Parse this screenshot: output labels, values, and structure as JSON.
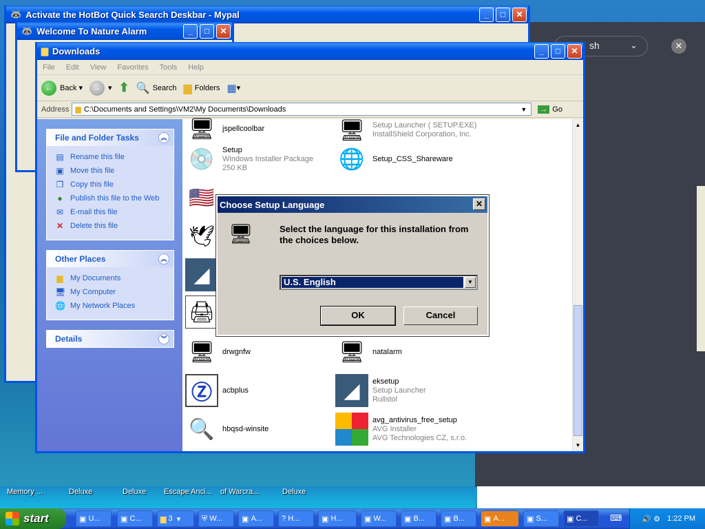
{
  "windows": {
    "hotbot": {
      "title": "Activate the HotBot Quick Search Deskbar - Mypal"
    },
    "alarm": {
      "title": "Welcome To Nature Alarm"
    },
    "explorer": {
      "title": "Downloads",
      "menu": [
        "File",
        "Edit",
        "View",
        "Favorites",
        "Tools",
        "Help"
      ],
      "toolbar": {
        "back": "Back",
        "search": "Search",
        "folders": "Folders"
      },
      "address_label": "Address",
      "address_value": "C:\\Documents and Settings\\VM2\\My Documents\\Downloads",
      "go_label": "Go"
    }
  },
  "taskpane": {
    "file_tasks": {
      "header": "File and Folder Tasks",
      "items": [
        "Rename this file",
        "Move this file",
        "Copy this file",
        "Publish this file to the Web",
        "E-mail this file",
        "Delete this file"
      ]
    },
    "other_places": {
      "header": "Other Places",
      "items": [
        "My Documents",
        "My Computer",
        "My Network Places"
      ]
    },
    "details": {
      "header": "Details"
    }
  },
  "files": [
    {
      "name": "jspellcoolbar",
      "line2": "",
      "line3": ""
    },
    {
      "name": "Setup Launcher ( SETUP.EXE)",
      "line2": "InstallShield Corporation, Inc.",
      "line3": ""
    },
    {
      "name": "Setup",
      "line2": "Windows Installer Package",
      "line3": "250 KB"
    },
    {
      "name": "Setup_CSS_Shareware",
      "line2": "",
      "line3": ""
    },
    {
      "name": "drwgnfw",
      "line2": "",
      "line3": ""
    },
    {
      "name": "natalarm",
      "line2": "",
      "line3": ""
    },
    {
      "name": "acbplus",
      "line2": "",
      "line3": ""
    },
    {
      "name": "eksetup",
      "line2": "Setup Launcher",
      "line3": "Rullstol"
    },
    {
      "name": "hbqsd-winsite",
      "line2": "",
      "line3": ""
    },
    {
      "name": "avg_antivirus_free_setup",
      "line2": "AVG Installer",
      "line3": "AVG Technologies CZ, s.r.o."
    }
  ],
  "dialog": {
    "title": "Choose Setup Language",
    "message": "Select the language for this installation from the choices below.",
    "selected_language": "U.S. English",
    "ok": "OK",
    "cancel": "Cancel"
  },
  "desktop_labels": [
    "Memory ...",
    "Deluxe",
    "Deluxe",
    "Escape Anci...",
    "of Warcra...",
    "Deluxe"
  ],
  "darkpane": {
    "search_text": "sh"
  },
  "taskbar": {
    "start": "start",
    "buttons": [
      "U...",
      "C...",
      "3",
      "W...",
      "A...",
      "H...",
      "H...",
      "W...",
      "B...",
      "B...",
      "A...",
      "S...",
      "C..."
    ],
    "clock": "1:22 PM"
  }
}
